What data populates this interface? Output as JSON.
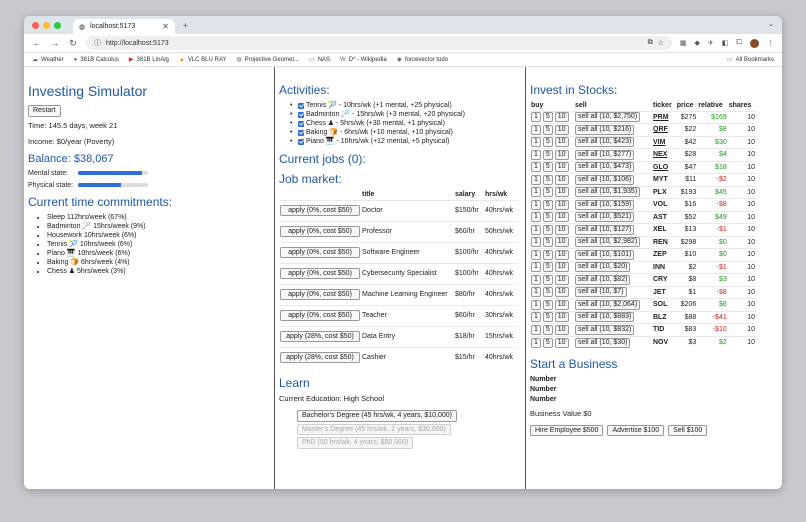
{
  "browser": {
    "tab_title": "localhost:5173",
    "url": "http://localhost:5173",
    "bookmarks": [
      "Weather",
      "381B Calculus",
      "381B LinAlg",
      "VLC BLU RAY",
      "Projective Geomet...",
      "NAS",
      "D* - Wikipedia",
      "forcevector todo"
    ],
    "all_bookmarks": "All Bookmarks"
  },
  "sim": {
    "title": "Investing Simulator",
    "restart": "Restart",
    "time": "Time: 145.5 days, week 21",
    "income": "Income: $0/year (Poverty)",
    "balance": "Balance: $38,067",
    "mental_label": "Mental state:",
    "mental_level": 0.92,
    "physical_label": "Physical state:",
    "physical_level": 0.62,
    "commitments_title": "Current time commitments:",
    "commitments": [
      "Sleep 112hrs/week (67%)",
      "Badminton 🏸 15hrs/week (9%)",
      "Housework 10hrs/week (6%)",
      "Tennis 🎾 10hrs/week (6%)",
      "Piano 🎹 10hrs/week (6%)",
      "Baking 🍞 6hrs/week (4%)",
      "Chess ♟ 5hrs/week (3%)"
    ]
  },
  "activities": {
    "title": "Activities:",
    "items": [
      "Tennis 🎾 - 10hrs/wk (+1 mental, +25 physical)",
      "Badminton 🏸 - 15hrs/wk (+3 mental, +20 physical)",
      "Chess ♟ - 5hrs/wk (+30 mental, +1 physical)",
      "Baking 🍞 - 6hrs/wk (+10 mental, +10 physical)",
      "Piano 🎹 - 10hrs/wk (+12 mental, +5 physical)"
    ],
    "jobs_title": "Current jobs (0):",
    "market_title": "Job market:",
    "headers": [
      "",
      "title",
      "salary",
      "hrs/wk"
    ],
    "jobs": [
      {
        "apply": "apply (0%, cost $50)",
        "title": "Doctor",
        "salary": "$150/hr",
        "hrs": "40hrs/wk"
      },
      {
        "apply": "apply (0%, cost $50)",
        "title": "Professor",
        "salary": "$60/hr",
        "hrs": "50hrs/wk"
      },
      {
        "apply": "apply (0%, cost $50)",
        "title": "Software Engineer",
        "salary": "$100/hr",
        "hrs": "40hrs/wk"
      },
      {
        "apply": "apply (0%, cost $50)",
        "title": "Cybersecurity Specialist",
        "salary": "$100/hr",
        "hrs": "40hrs/wk"
      },
      {
        "apply": "apply (0%, cost $50)",
        "title": "Machine Learning Engineer",
        "salary": "$80/hr",
        "hrs": "40hrs/wk"
      },
      {
        "apply": "apply (0%, cost $50)",
        "title": "Teacher",
        "salary": "$60/hr",
        "hrs": "30hrs/wk"
      },
      {
        "apply": "apply (28%, cost $50)",
        "title": "Data Entry",
        "salary": "$18/hr",
        "hrs": "15hrs/wk"
      },
      {
        "apply": "apply (28%, cost $50)",
        "title": "Cashier",
        "salary": "$15/hr",
        "hrs": "40hrs/wk"
      }
    ],
    "learn_title": "Learn",
    "education": "Current Education: High School",
    "degrees": [
      "Bachelor's Degree (45 hrs/wk, 4 years, $10,000)",
      "Master's Degree (45 hrs/wk, 2 years, $30,000)",
      "PhD (50 hrs/wk, 4 years, $50,000)"
    ]
  },
  "stocks": {
    "title": "Invest in Stocks:",
    "headers": [
      "buy",
      "sell",
      "ticker",
      "price",
      "relative",
      "shares"
    ],
    "buy_labels": [
      "1",
      "5",
      "10"
    ],
    "rows": [
      {
        "sell": "sell all (10, $2,750)",
        "ticker": "PRM",
        "price": "$275",
        "rel": "$169",
        "shares": "10",
        "dir": "pos",
        "link": true
      },
      {
        "sell": "sell all (10, $216)",
        "ticker": "QRF",
        "price": "$22",
        "rel": "$8",
        "shares": "10",
        "dir": "pos",
        "link": true
      },
      {
        "sell": "sell all (10, $423)",
        "ticker": "VIM",
        "price": "$42",
        "rel": "$30",
        "shares": "10",
        "dir": "pos",
        "link": true
      },
      {
        "sell": "sell all (10, $277)",
        "ticker": "NEX",
        "price": "$28",
        "rel": "$4",
        "shares": "10",
        "dir": "pos",
        "link": true
      },
      {
        "sell": "sell all (10, $473)",
        "ticker": "GLO",
        "price": "$47",
        "rel": "$18",
        "shares": "10",
        "dir": "pos",
        "link": true
      },
      {
        "sell": "sell all (10, $106)",
        "ticker": "MYT",
        "price": "$11",
        "rel": "-$2",
        "shares": "10",
        "dir": "neg",
        "link": false
      },
      {
        "sell": "sell all (10, $1,935)",
        "ticker": "PLX",
        "price": "$193",
        "rel": "$45",
        "shares": "10",
        "dir": "pos",
        "link": false
      },
      {
        "sell": "sell all (10, $159)",
        "ticker": "VOL",
        "price": "$16",
        "rel": "-$8",
        "shares": "10",
        "dir": "neg",
        "link": false
      },
      {
        "sell": "sell all (10, $521)",
        "ticker": "AST",
        "price": "$52",
        "rel": "$49",
        "shares": "10",
        "dir": "pos",
        "link": false
      },
      {
        "sell": "sell all (10, $127)",
        "ticker": "XEL",
        "price": "$13",
        "rel": "-$1",
        "shares": "10",
        "dir": "neg",
        "link": false
      },
      {
        "sell": "sell all (10, $2,982)",
        "ticker": "REN",
        "price": "$298",
        "rel": "$0",
        "shares": "10",
        "dir": "pos",
        "link": false
      },
      {
        "sell": "sell all (10, $101)",
        "ticker": "ZEP",
        "price": "$10",
        "rel": "$0",
        "shares": "10",
        "dir": "pos",
        "link": false
      },
      {
        "sell": "sell all (10, $20)",
        "ticker": "INN",
        "price": "$2",
        "rel": "-$1",
        "shares": "10",
        "dir": "neg",
        "link": false
      },
      {
        "sell": "sell all (10, $82)",
        "ticker": "CRY",
        "price": "$8",
        "rel": "$3",
        "shares": "10",
        "dir": "pos",
        "link": false
      },
      {
        "sell": "sell all (10, $7)",
        "ticker": "JET",
        "price": "$1",
        "rel": "-$8",
        "shares": "10",
        "dir": "neg",
        "link": false
      },
      {
        "sell": "sell all (10, $2,064)",
        "ticker": "SOL",
        "price": "$206",
        "rel": "$6",
        "shares": "10",
        "dir": "pos",
        "link": false
      },
      {
        "sell": "sell all (10, $883)",
        "ticker": "BLZ",
        "price": "$88",
        "rel": "-$41",
        "shares": "10",
        "dir": "neg",
        "link": false
      },
      {
        "sell": "sell all (10, $832)",
        "ticker": "TID",
        "price": "$83",
        "rel": "-$10",
        "shares": "10",
        "dir": "neg",
        "link": false
      },
      {
        "sell": "sell all (10, $30)",
        "ticker": "NOV",
        "price": "$3",
        "rel": "$2",
        "shares": "10",
        "dir": "pos",
        "link": false
      }
    ],
    "business_title": "Start a Business",
    "number_labels": [
      "Number",
      "Number",
      "Number"
    ],
    "business_value": "Business Value $0",
    "business_buttons": [
      "Hire Employee $500",
      "Advertise $100",
      "Sell $100"
    ]
  },
  "colors": {
    "heading": "#1f5aa6",
    "positive": "#1a9a1a",
    "negative": "#d02020",
    "bar_fill": "#2d6fd6"
  }
}
